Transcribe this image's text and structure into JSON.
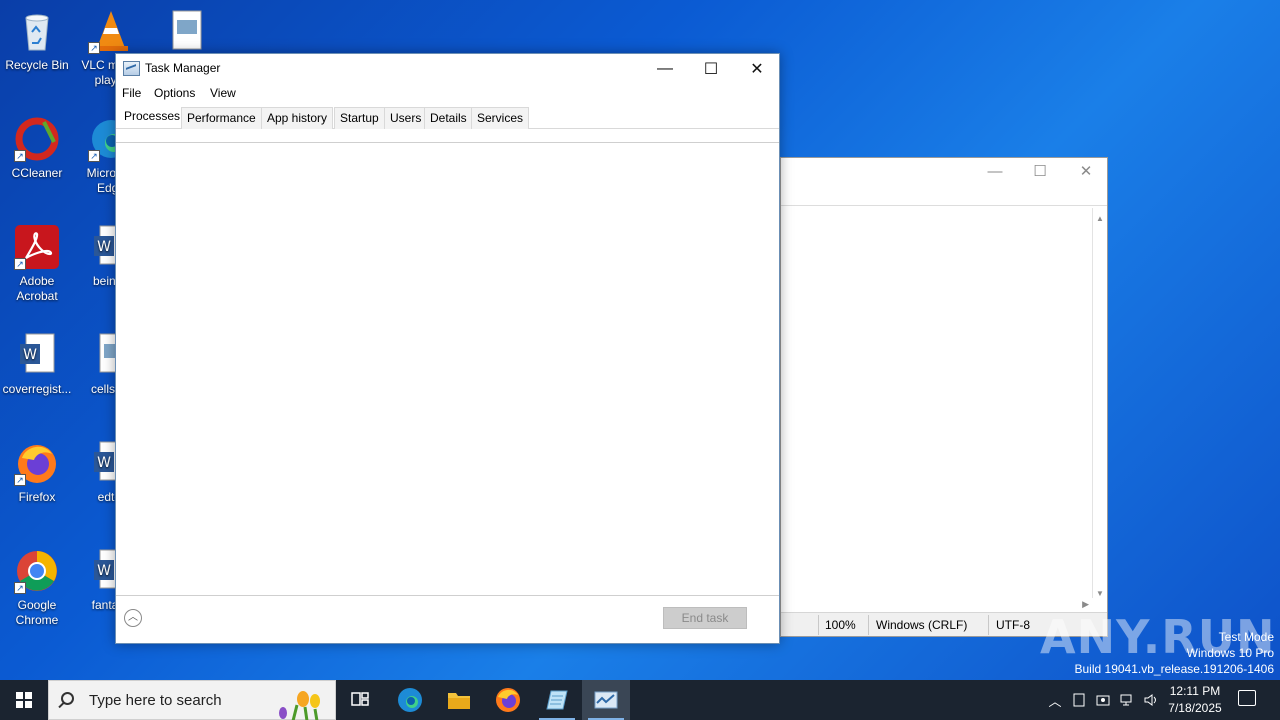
{
  "desktop": {
    "icons": [
      {
        "label": "Recycle Bin"
      },
      {
        "label": "VLC media player"
      },
      {
        "label": "CCleaner"
      },
      {
        "label": "Microsoft Edge"
      },
      {
        "label": "Adobe Acrobat"
      },
      {
        "label": "beingh"
      },
      {
        "label": "coverregist..."
      },
      {
        "label": "cellssm"
      },
      {
        "label": "Firefox"
      },
      {
        "label": "edtot"
      },
      {
        "label": "Google Chrome"
      },
      {
        "label": "fantasy"
      }
    ]
  },
  "notepad": {
    "status": {
      "zoom": "100%",
      "line_ending": "Windows (CRLF)",
      "encoding": "UTF-8"
    },
    "controls": {
      "minimize": "—",
      "maximize": "☐",
      "close": "✕"
    }
  },
  "task_manager": {
    "title": "Task Manager",
    "controls": {
      "minimize": "—",
      "maximize": "☐",
      "close": "✕"
    },
    "menu": [
      "File",
      "Options",
      "View"
    ],
    "tabs": [
      "Processes",
      "Performance",
      "App history",
      "Startup",
      "Users",
      "Details",
      "Services"
    ],
    "active_tab": "Processes",
    "fewer_details_icon": "chevron-up-icon",
    "end_task_label": "End task"
  },
  "watermark": {
    "brand": "ANY.RUN",
    "line1": "Test Mode",
    "line2": "Windows 10 Pro",
    "line3": "Build 19041.vb_release.191206-1406"
  },
  "taskbar": {
    "search_placeholder": "Type here to search",
    "time": "12:11 PM",
    "date": "7/18/2025"
  }
}
